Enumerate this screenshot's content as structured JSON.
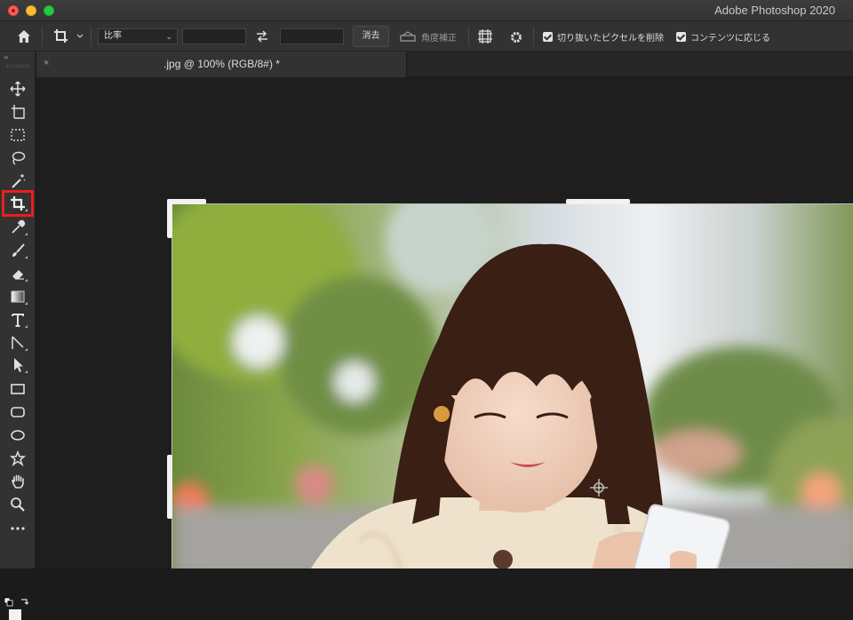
{
  "app": {
    "title": "Adobe Photoshop 2020"
  },
  "options": {
    "ratio_label": "比率",
    "clear_label": "消去",
    "straighten_label": "角度補正",
    "delete_cropped_label": "切り抜いたピクセルを削除",
    "content_aware_label": "コンテンツに応じる"
  },
  "toolbar": {
    "collapse_label": "››",
    "tools": [
      {
        "name": "move-tool",
        "icon": "move-icon"
      },
      {
        "name": "artboard-tool",
        "icon": "artboard-icon"
      },
      {
        "name": "marquee-tool",
        "icon": "marquee-icon"
      },
      {
        "name": "lasso-tool",
        "icon": "lasso-icon"
      },
      {
        "name": "magic-wand-tool",
        "icon": "magic-wand-icon"
      },
      {
        "name": "crop-tool",
        "icon": "crop-icon",
        "selected": true
      },
      {
        "name": "eyedropper-tool",
        "icon": "eyedropper-icon"
      },
      {
        "name": "brush-tool",
        "icon": "brush-icon"
      },
      {
        "name": "eraser-tool",
        "icon": "eraser-icon"
      },
      {
        "name": "gradient-tool",
        "icon": "gradient-icon"
      },
      {
        "name": "type-tool",
        "icon": "type-icon"
      },
      {
        "name": "pen-tool",
        "icon": "pen-icon"
      },
      {
        "name": "path-selection-tool",
        "icon": "arrow-icon"
      },
      {
        "name": "rectangle-tool",
        "icon": "rectangle-icon"
      },
      {
        "name": "rounded-rectangle-tool",
        "icon": "rounded-rect-icon"
      },
      {
        "name": "ellipse-tool",
        "icon": "ellipse-icon"
      },
      {
        "name": "custom-shape-tool",
        "icon": "custom-shape-icon"
      },
      {
        "name": "hand-tool",
        "icon": "hand-icon"
      },
      {
        "name": "zoom-tool",
        "icon": "zoom-icon"
      },
      {
        "name": "more-tools",
        "icon": "ellipsis-icon"
      }
    ]
  },
  "document": {
    "close_label": "×",
    "tab_title": ".jpg @ 100% (RGB/8#) *"
  },
  "colors": {
    "highlight": "#ee1c1c",
    "panel": "#323232",
    "canvas": "#1e1e1e"
  }
}
